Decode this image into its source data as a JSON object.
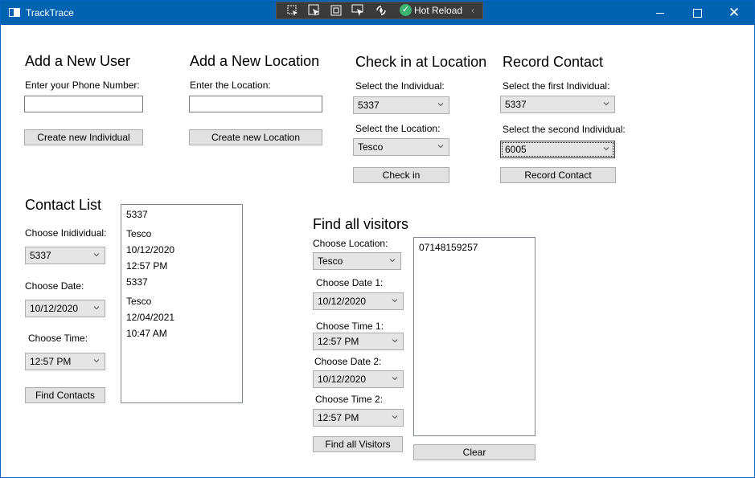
{
  "window": {
    "title": "TrackTrace"
  },
  "debug_toolbar": {
    "hot_reload_label": "Hot Reload"
  },
  "add_user": {
    "heading": "Add a New User",
    "phone_label": "Enter your Phone Number:",
    "phone_value": "",
    "button": "Create new Individual"
  },
  "add_location": {
    "heading": "Add a New Location",
    "location_label": "Enter the Location:",
    "location_value": "",
    "button": "Create new Location"
  },
  "check_in": {
    "heading": "Check in at Location",
    "individual_label": "Select the Individual:",
    "individual_value": "5337",
    "location_label": "Select the Location:",
    "location_value": "Tesco",
    "button": "Check in"
  },
  "record_contact": {
    "heading": "Record Contact",
    "first_label": "Select the first Individual:",
    "first_value": "5337",
    "second_label": "Select the second Individual:",
    "second_value": "6005",
    "button": "Record Contact"
  },
  "contact_list": {
    "heading": "Contact List",
    "individual_label": "Choose Inidividual:",
    "individual_value": "5337",
    "date_label": "Choose Date:",
    "date_value": "10/12/2020",
    "time_label": "Choose Time:",
    "time_value": "12:57 PM",
    "button": "Find Contacts",
    "results": [
      "5337",
      "Tesco",
      "10/12/2020",
      "12:57 PM",
      "5337",
      "Tesco",
      "12/04/2021",
      "10:47 AM"
    ]
  },
  "find_visitors": {
    "heading": "Find all visitors",
    "location_label": "Choose Location:",
    "location_value": "Tesco",
    "date1_label": "Choose Date 1:",
    "date1_value": "10/12/2020",
    "time1_label": "Choose Time 1:",
    "time1_value": "12:57 PM",
    "date2_label": "Choose Date 2:",
    "date2_value": "10/12/2020",
    "time2_label": "Choose Time 2:",
    "time2_value": "12:57 PM",
    "button": "Find all Visitors",
    "clear_button": "Clear",
    "results": [
      "07148159257"
    ]
  }
}
